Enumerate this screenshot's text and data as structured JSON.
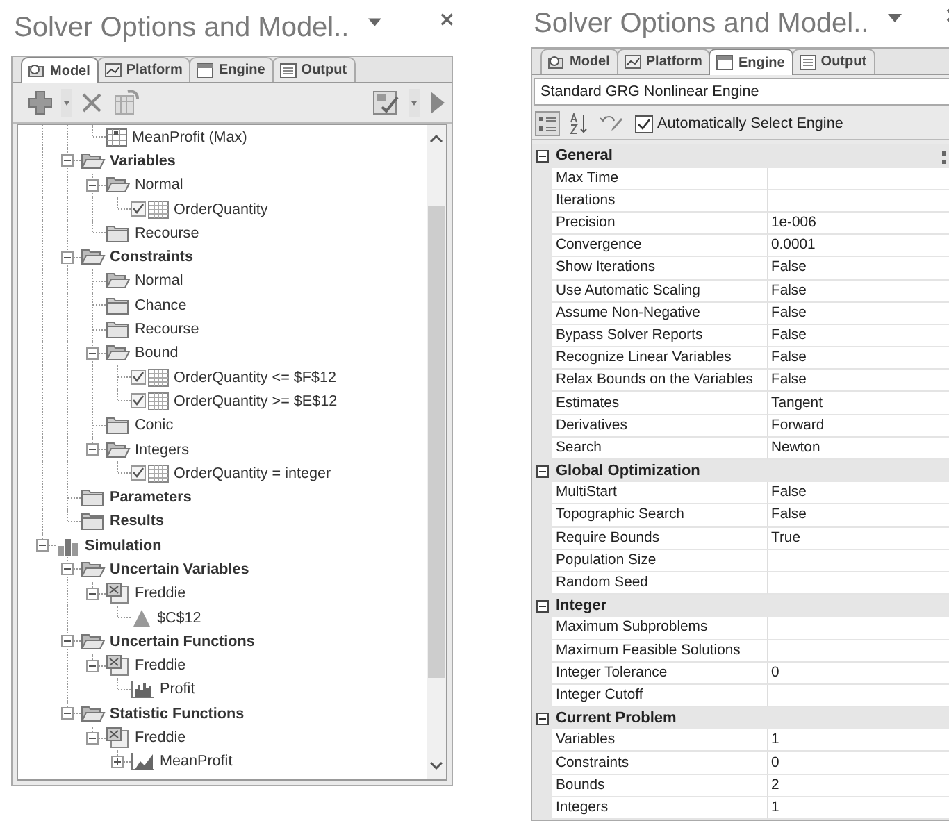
{
  "left": {
    "title": "Solver Options and Model..",
    "tabs": [
      {
        "label": "Model",
        "kind": "model",
        "selected": true
      },
      {
        "label": "Platform",
        "kind": "platform",
        "selected": false
      },
      {
        "label": "Engine",
        "kind": "engine",
        "selected": false
      },
      {
        "label": "Output",
        "kind": "output",
        "selected": false
      }
    ],
    "tree": {
      "items": [
        {
          "children": [
            {
              "children": [
                {
                  "label": "MeanProfit (Max)",
                  "kind": "objective"
                }
              ]
            },
            {
              "label": "Variables",
              "kind": "folder",
              "open": true,
              "expanded": true,
              "children": [
                {
                  "label": "Normal",
                  "kind": "folder",
                  "open": true,
                  "expanded": true,
                  "children": [
                    {
                      "label": "OrderQuantity",
                      "kind": "cell",
                      "checked": true
                    }
                  ]
                },
                {
                  "label": "Recourse",
                  "kind": "folder",
                  "open": false
                }
              ]
            },
            {
              "label": "Constraints",
              "kind": "folder",
              "open": true,
              "expanded": true,
              "children": [
                {
                  "label": "Normal",
                  "kind": "folder",
                  "open": true
                },
                {
                  "label": "Chance",
                  "kind": "folder",
                  "open": false
                },
                {
                  "label": "Recourse",
                  "kind": "folder",
                  "open": false
                },
                {
                  "label": "Bound",
                  "kind": "folder",
                  "open": true,
                  "expanded": true,
                  "children": [
                    {
                      "label": "OrderQuantity <= $F$12",
                      "kind": "cell",
                      "checked": true
                    },
                    {
                      "label": "OrderQuantity >= $E$12",
                      "kind": "cell",
                      "checked": true
                    }
                  ]
                },
                {
                  "label": "Conic",
                  "kind": "folder",
                  "open": false
                },
                {
                  "label": "Integers",
                  "kind": "folder",
                  "open": true,
                  "expanded": true,
                  "children": [
                    {
                      "label": "OrderQuantity = integer",
                      "kind": "cell",
                      "checked": true
                    }
                  ]
                }
              ]
            },
            {
              "label": "Parameters",
              "kind": "folder",
              "open": false
            },
            {
              "label": "Results",
              "kind": "folder",
              "open": false
            }
          ]
        },
        {
          "label": "Simulation",
          "kind": "simulation",
          "expanded": true,
          "children": [
            {
              "label": "Uncertain Variables",
              "kind": "folder",
              "open": true,
              "expanded": true,
              "children": [
                {
                  "label": "Freddie",
                  "kind": "sheet",
                  "expanded": true,
                  "children": [
                    {
                      "label": "$C$12",
                      "kind": "distribution"
                    }
                  ]
                }
              ]
            },
            {
              "label": "Uncertain Functions",
              "kind": "folder",
              "open": true,
              "expanded": true,
              "children": [
                {
                  "label": "Freddie",
                  "kind": "sheet",
                  "expanded": true,
                  "children": [
                    {
                      "label": "Profit",
                      "kind": "histogram"
                    }
                  ]
                }
              ]
            },
            {
              "label": "Statistic Functions",
              "kind": "folder",
              "open": true,
              "expanded": true,
              "children": [
                {
                  "label": "Freddie",
                  "kind": "sheet",
                  "expanded": true,
                  "children": [
                    {
                      "label": "MeanProfit",
                      "kind": "statistic",
                      "expanded": false
                    }
                  ]
                }
              ]
            }
          ]
        }
      ]
    }
  },
  "right": {
    "title": "Solver Options and Model..",
    "tabs": [
      {
        "label": "Model",
        "kind": "model",
        "selected": false
      },
      {
        "label": "Platform",
        "kind": "platform",
        "selected": false
      },
      {
        "label": "Engine",
        "kind": "engine",
        "selected": true
      },
      {
        "label": "Output",
        "kind": "output",
        "selected": false
      }
    ],
    "engine_select": {
      "value": "Standard GRG Nonlinear Engine"
    },
    "auto_select": {
      "label": "Automatically Select Engine",
      "checked": true
    },
    "property_grid": {
      "categories": [
        {
          "name": "General",
          "expanded": true,
          "rows": [
            {
              "name": "Max Time"
            },
            {
              "name": "Iterations"
            },
            {
              "name": "Precision",
              "value": "1e-006"
            },
            {
              "name": "Convergence",
              "value": "0.0001"
            },
            {
              "name": "Show Iterations",
              "value": "False"
            },
            {
              "name": "Use Automatic Scaling",
              "value": "False"
            },
            {
              "name": "Assume Non-Negative",
              "value": "False"
            },
            {
              "name": "Bypass Solver Reports",
              "value": "False"
            },
            {
              "name": "Recognize Linear Variables",
              "value": "False"
            },
            {
              "name": "Relax Bounds on the Variables",
              "value": "False"
            },
            {
              "name": "Estimates",
              "value": "Tangent"
            },
            {
              "name": "Derivatives",
              "value": "Forward"
            },
            {
              "name": "Search",
              "value": "Newton"
            }
          ]
        },
        {
          "name": "Global Optimization",
          "expanded": true,
          "rows": [
            {
              "name": "MultiStart",
              "value": "False"
            },
            {
              "name": "Topographic Search",
              "value": "False"
            },
            {
              "name": "Require Bounds",
              "value": "True"
            },
            {
              "name": "Population Size"
            },
            {
              "name": "Random Seed"
            }
          ]
        },
        {
          "name": "Integer",
          "expanded": true,
          "rows": [
            {
              "name": "Maximum Subproblems"
            },
            {
              "name": "Maximum Feasible Solutions"
            },
            {
              "name": "Integer Tolerance",
              "value": "0"
            },
            {
              "name": "Integer Cutoff"
            }
          ]
        },
        {
          "name": "Current Problem",
          "expanded": true,
          "rows": [
            {
              "name": "Variables",
              "value": "1"
            },
            {
              "name": "Constraints",
              "value": "0"
            },
            {
              "name": "Bounds",
              "value": "2"
            },
            {
              "name": "Integers",
              "value": "1"
            }
          ]
        }
      ]
    }
  }
}
